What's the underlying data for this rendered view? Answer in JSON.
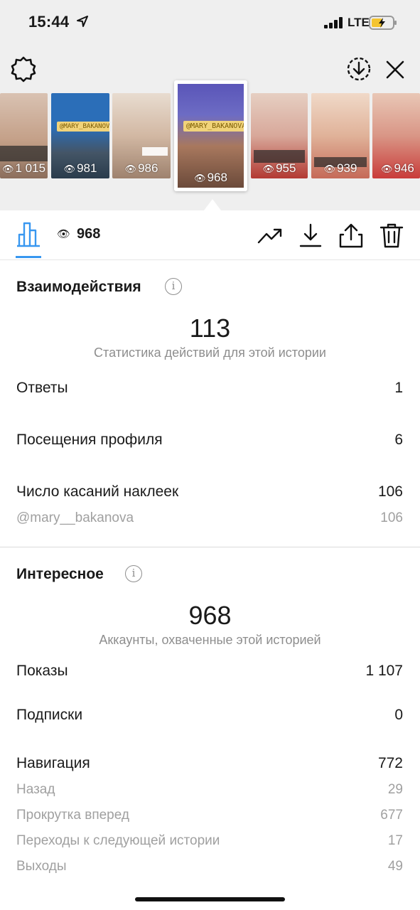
{
  "status": {
    "time": "15:44",
    "network": "LTE"
  },
  "stories": [
    {
      "views": "1 015",
      "tag": ""
    },
    {
      "views": "981",
      "tag": "@MARY_BAKANOVA"
    },
    {
      "views": "986",
      "tag": ""
    },
    {
      "views": "968",
      "tag": "@MARY_BAKANOVA",
      "selected": true
    },
    {
      "views": "955",
      "tag": ""
    },
    {
      "views": "939",
      "tag": ""
    },
    {
      "views": "946",
      "tag": ""
    }
  ],
  "toolbar": {
    "reach": "968"
  },
  "interactions": {
    "title": "Взаимодействия",
    "total": "113",
    "subtitle": "Статистика действий для этой истории",
    "rows": [
      {
        "label": "Ответы",
        "value": "1"
      },
      {
        "label": "Посещения профиля",
        "value": "6"
      },
      {
        "label": "Число касаний наклеек",
        "value": "106"
      }
    ],
    "sticker": {
      "label": "@mary__bakanova",
      "value": "106"
    }
  },
  "discovery": {
    "title": "Интересное",
    "total": "968",
    "subtitle": "Аккаунты, охваченные этой историей",
    "rows": [
      {
        "label": "Показы",
        "value": "1 107"
      },
      {
        "label": "Подписки",
        "value": "0"
      },
      {
        "label": "Навигация",
        "value": "772"
      }
    ],
    "navigation": [
      {
        "label": "Назад",
        "value": "29"
      },
      {
        "label": "Прокрутка вперед",
        "value": "677"
      },
      {
        "label": "Переходы к следующей истории",
        "value": "17"
      },
      {
        "label": "Выходы",
        "value": "49"
      }
    ]
  },
  "colors": {
    "accent": "#3897f0",
    "muted": "#8e8e8e",
    "topBackground": "#efefef"
  },
  "icons": [
    "location-arrow-icon",
    "signal-icon",
    "battery-icon",
    "gear-icon",
    "download-circle-icon",
    "close-icon",
    "bar-chart-icon",
    "eye-icon",
    "trending-icon",
    "download-icon",
    "share-icon",
    "trash-icon",
    "info-icon"
  ]
}
